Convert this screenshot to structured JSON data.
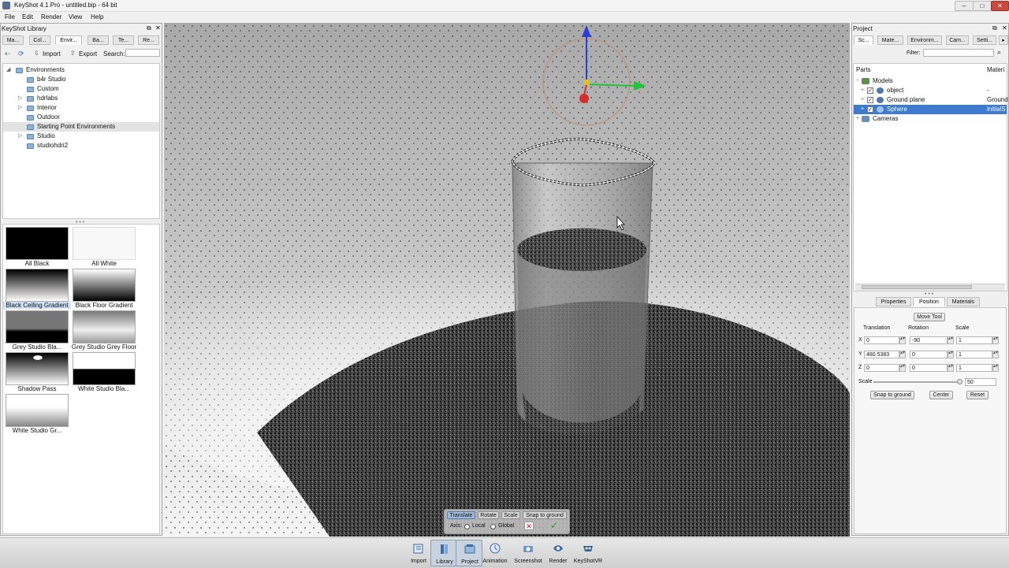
{
  "window": {
    "title": "KeyShot 4.1 Pro  - untitled.bip  - 64 bit",
    "min": "–",
    "max": "□",
    "close": "✕"
  },
  "menu": [
    "File",
    "Edit",
    "Render",
    "View",
    "Help"
  ],
  "library": {
    "title": "KeyShot Library",
    "tabs": [
      "Ma...",
      "Col...",
      "Envir...",
      "Ba...",
      "Te...",
      "Re..."
    ],
    "toolbar": {
      "import": "Import",
      "export": "Export",
      "search_label": "Search:",
      "search_value": ""
    },
    "tree": [
      {
        "label": "Environments"
      },
      {
        "label": "b4r Studio"
      },
      {
        "label": "Custom"
      },
      {
        "label": "hdrlabs"
      },
      {
        "label": "Interior"
      },
      {
        "label": "Outdoor"
      },
      {
        "label": "Starting Point Environments"
      },
      {
        "label": "Studio"
      },
      {
        "label": "studiohdri2"
      }
    ],
    "thumbnails": [
      {
        "label": "All Black"
      },
      {
        "label": "All White"
      },
      {
        "label": "Black Ceiling Gradient"
      },
      {
        "label": "Black Floor Gradient"
      },
      {
        "label": "Grey Studio Bla..."
      },
      {
        "label": "Grey Studio Grey Floor"
      },
      {
        "label": "Shadow Pass"
      },
      {
        "label": "White Studio Bla..."
      },
      {
        "label": "White Studio Gr..."
      }
    ]
  },
  "project": {
    "title": "Project",
    "tabs": [
      "Sc...",
      "Mate...",
      "Environm...",
      "Cam...",
      "Setti..."
    ],
    "filter_label": "Filter:",
    "filter_value": "",
    "columns": {
      "parts": "Parts",
      "material": "Materi"
    },
    "tree": {
      "models": "Models",
      "object": {
        "label": "object",
        "material": "-"
      },
      "ground": {
        "label": "Ground plane",
        "material": "Ground"
      },
      "sphere": {
        "label": "Sphere",
        "material": "initialS"
      },
      "cameras": "Cameras"
    },
    "sub_tabs": [
      "Properties",
      "Position",
      "Materials"
    ],
    "move_tool": "Move Tool",
    "headers": {
      "translation": "Translation",
      "rotation": "Rotation",
      "scale": "Scale"
    },
    "axes": [
      "X",
      "Y",
      "Z"
    ],
    "translation": [
      "0",
      "480.5383",
      "0"
    ],
    "rotation": [
      "-90",
      "0",
      "0"
    ],
    "scale_vals": [
      "1",
      "1",
      "1"
    ],
    "uniform_scale_label": "Scale",
    "uniform_scale_value": "50",
    "buttons": {
      "snap": "Snap to ground",
      "center": "Center",
      "reset": "Reset"
    }
  },
  "overlay": {
    "buttons": [
      "Translate",
      "Rotate",
      "Scale",
      "Snap to ground"
    ],
    "axis_label": "Axis:",
    "local": "Local",
    "global": "Global",
    "cancel": "✕",
    "confirm": "✓"
  },
  "bottom_tools": [
    "Import",
    "Library",
    "Project",
    "Animation",
    "Screenshot",
    "Render",
    "KeyShotVR"
  ]
}
